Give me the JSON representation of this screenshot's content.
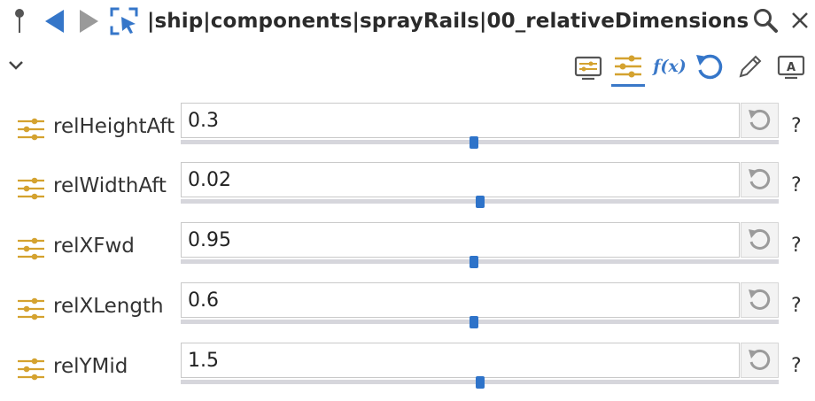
{
  "header": {
    "path": "|ship|components|sprayRails|00_relativeDimensions",
    "icons": [
      "pin-icon",
      "back-arrow-icon",
      "forward-arrow-icon",
      "select-cursor-icon",
      "search-icon",
      "close-icon"
    ]
  },
  "subbar": {
    "fx_label": "f(x)",
    "text_badge_label": "A",
    "icons": [
      "chevron-down-icon",
      "monitor-parameter-icon",
      "parameters-icon",
      "function-icon",
      "undo-icon",
      "edit-icon",
      "text-annotation-icon"
    ],
    "active_tab": "parameters-icon"
  },
  "colors": {
    "accent_blue": "#2e73c9",
    "param_icon_gold": "#d4a22f",
    "active_underline": "#3a78c8"
  },
  "parameters": [
    {
      "name": "relHeightAft",
      "value": "0.3",
      "slider_level": 0.49,
      "help": "?"
    },
    {
      "name": "relWidthAft",
      "value": "0.02",
      "slider_level": 0.5,
      "help": "?"
    },
    {
      "name": "relXFwd",
      "value": "0.95",
      "slider_level": 0.49,
      "help": "?"
    },
    {
      "name": "relXLength",
      "value": "0.6",
      "slider_level": 0.49,
      "help": "?"
    },
    {
      "name": "relYMid",
      "value": "1.5",
      "slider_level": 0.5,
      "help": "?"
    }
  ]
}
